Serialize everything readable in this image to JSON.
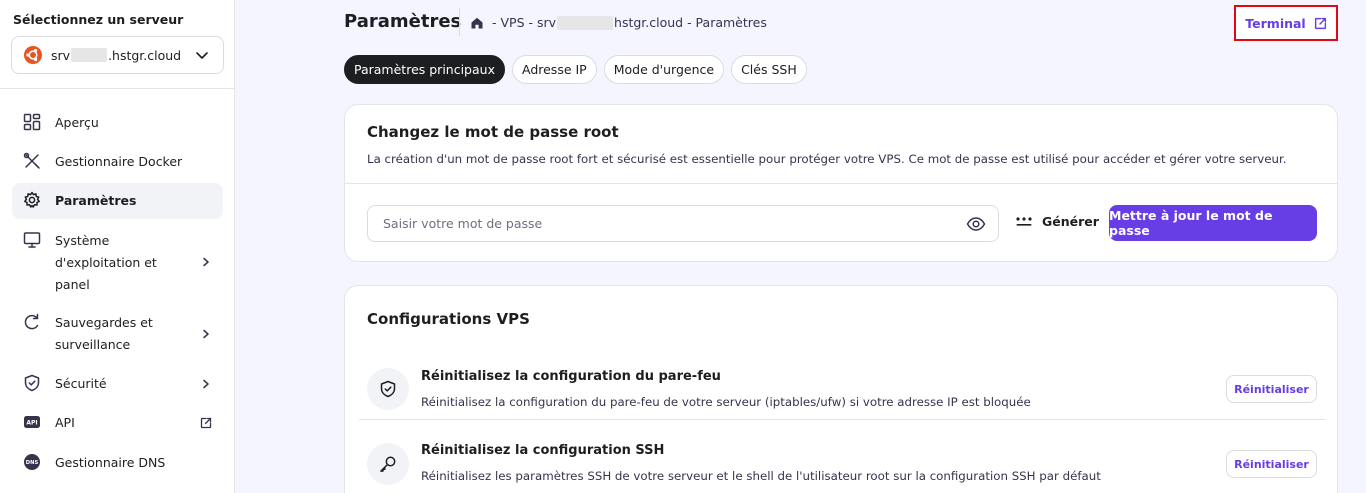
{
  "sidebar": {
    "title": "Sélectionnez un serveur",
    "server": {
      "prefix": "srv",
      "suffix": ".hstgr.cloud",
      "os_icon": "ubuntu-icon"
    },
    "items": [
      {
        "label": "Aperçu",
        "icon": "overview-grid-icon"
      },
      {
        "label": "Gestionnaire Docker",
        "icon": "docker-tools-icon"
      },
      {
        "label": "Paramètres",
        "icon": "gear-icon",
        "active": true
      },
      {
        "label": "Système d'exploitation et panel",
        "label_lines": [
          "Système",
          "d'exploitation et",
          "panel"
        ],
        "icon": "monitor-icon",
        "trail": "chevron-right-icon"
      },
      {
        "label": "Sauvegardes et surveillance",
        "label_lines": [
          "Sauvegardes et",
          "surveillance"
        ],
        "icon": "refresh-icon",
        "trail": "chevron-right-icon"
      },
      {
        "label": "Sécurité",
        "icon": "shield-icon",
        "trail": "chevron-right-icon"
      },
      {
        "label": "API",
        "icon": "api-icon",
        "trail": "external-link-icon"
      },
      {
        "label": "Gestionnaire DNS",
        "icon": "dns-icon"
      }
    ]
  },
  "header": {
    "title": "Paramètres",
    "breadcrumb": {
      "part1": "- VPS - srv",
      "part2": "hstgr.cloud - Paramètres"
    },
    "terminal_label": "Terminal"
  },
  "tabs": [
    {
      "label": "Paramètres principaux",
      "active": true
    },
    {
      "label": "Adresse IP"
    },
    {
      "label": "Mode d'urgence"
    },
    {
      "label": "Clés SSH"
    }
  ],
  "password_card": {
    "title": "Changez le mot de passe root",
    "description": "La création d'un mot de passe root fort et sécurisé est essentielle pour protéger votre VPS. Ce mot de passe est utilisé pour accéder et gérer votre serveur.",
    "input_placeholder": "Saisir votre mot de passe",
    "input_value": "",
    "generate_label": "Générer",
    "update_label": "Mettre à jour le mot de passe"
  },
  "config_card": {
    "title": "Configurations VPS",
    "rows": [
      {
        "title": "Réinitialisez la configuration du pare-feu",
        "description": "Réinitialisez la configuration du pare-feu de votre serveur (iptables/ufw) si votre adresse IP est bloquée",
        "button": "Réinitialiser",
        "icon": "shield-check-icon"
      },
      {
        "title": "Réinitialisez la configuration SSH",
        "description": "Réinitialisez les paramètres SSH de votre serveur et le shell de l'utilisateur root sur la configuration SSH par défaut",
        "button": "Réinitialiser",
        "icon": "key-icon"
      }
    ]
  },
  "colors": {
    "accent": "#673de6",
    "highlight_border": "#e30613",
    "ubuntu": "#e95420",
    "text": "#1d1e20"
  }
}
